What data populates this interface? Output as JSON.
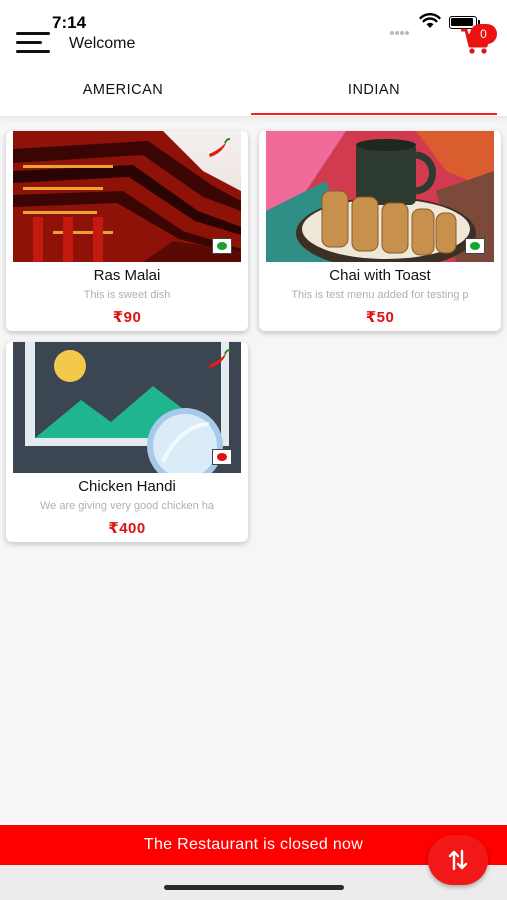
{
  "status_bar": {
    "time": "7:14"
  },
  "header": {
    "welcome": "Welcome",
    "cart_count": "0"
  },
  "tabs": [
    {
      "label": "AMERICAN",
      "selected": false
    },
    {
      "label": "INDIAN",
      "selected": true
    }
  ],
  "items": [
    {
      "name": "Ras Malai",
      "description": "This is sweet dish",
      "price": "₹90",
      "diet": "veg",
      "spicy": true
    },
    {
      "name": "Chai with Toast",
      "description": "This is test menu added for testing p",
      "price": "₹50",
      "diet": "veg",
      "spicy": false
    },
    {
      "name": "Chicken Handi",
      "description": "We are giving very good chicken ha",
      "price": "₹400",
      "diet": "non-veg",
      "spicy": true
    }
  ],
  "banner": {
    "text": "The Restaurant is closed now"
  },
  "colors": {
    "accent": "#ff0000",
    "veg": "#1aa22f",
    "non_veg": "#dd1111",
    "price": "#e01111"
  }
}
